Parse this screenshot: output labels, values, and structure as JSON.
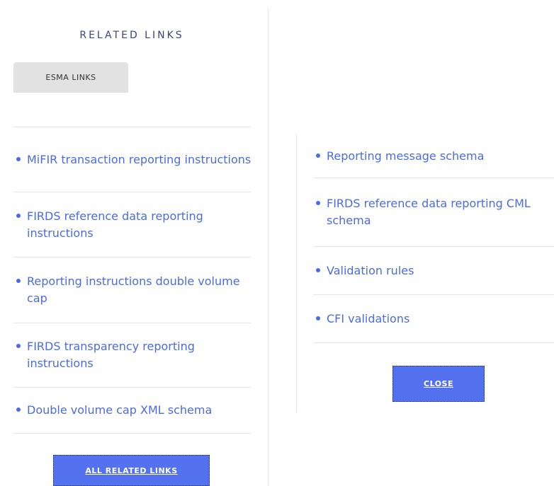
{
  "related": {
    "title": "RELATED LINKS",
    "tab_label": "ESMA LINKS"
  },
  "left_links": [
    "MiFIR transaction reporting instructions",
    "FIRDS reference data reporting instructions",
    "Reporting instructions double volume cap",
    "FIRDS transparency reporting instructions",
    "Double volume cap XML schema"
  ],
  "right_links": [
    "Reporting message schema",
    "FIRDS reference data reporting CML schema",
    "Validation rules",
    "CFI validations"
  ],
  "buttons": {
    "all_related_links": "ALL RELATED LINKS",
    "close": "CLOSE"
  },
  "colors": {
    "link": "#4b6be6",
    "button": "#5472f0",
    "title": "#3a4480",
    "tab": "#e2e2e2"
  }
}
